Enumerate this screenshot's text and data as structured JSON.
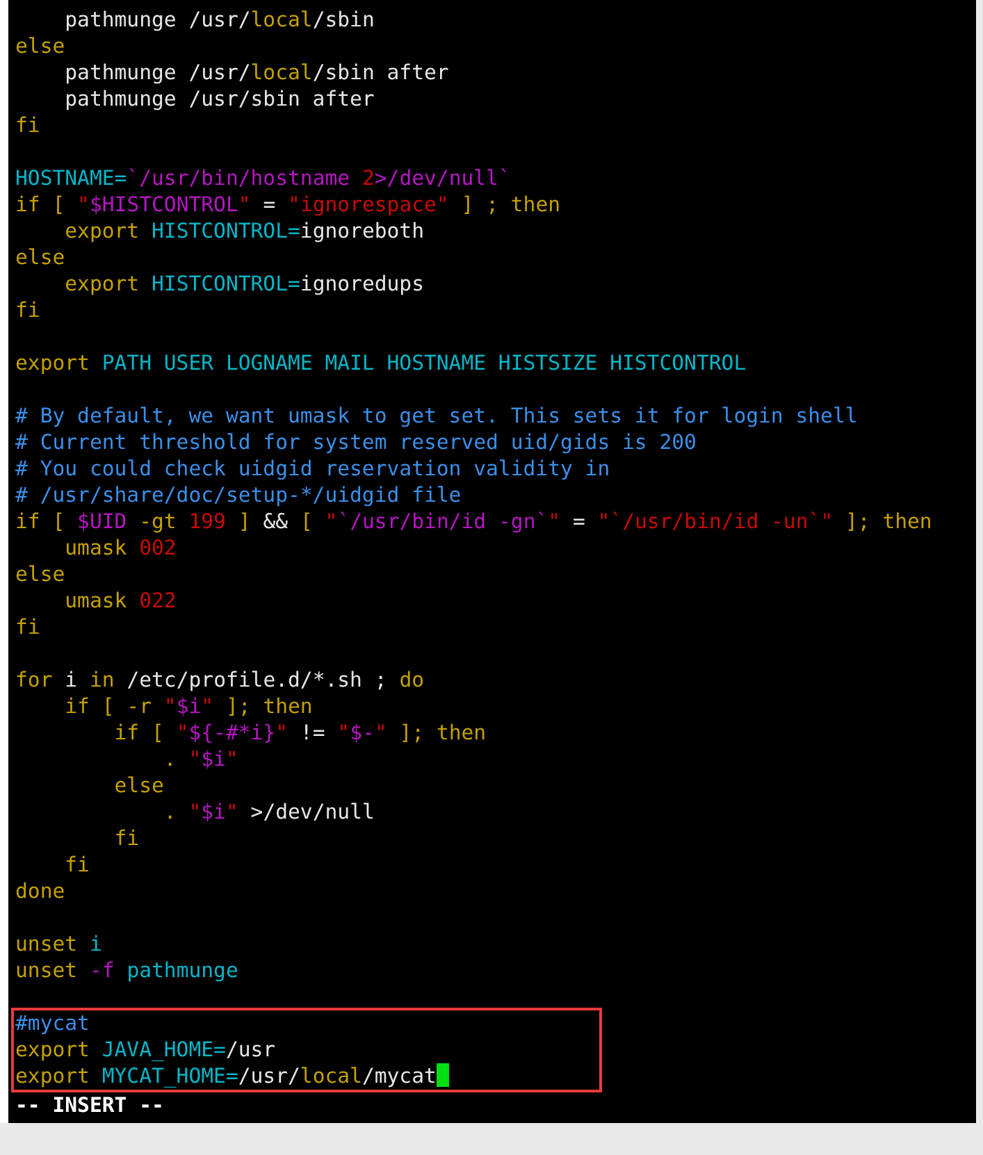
{
  "editor": {
    "blocks": [
      {
        "highlighted": false,
        "lines": [
          {
            "segments": [
              {
                "kind": "plain",
                "text": "    pathmunge /usr/"
              },
              {
                "kind": "keyword",
                "text": "local"
              },
              {
                "kind": "plain",
                "text": "/sbin"
              }
            ]
          },
          {
            "segments": [
              {
                "kind": "keyword",
                "text": "else"
              }
            ]
          },
          {
            "segments": [
              {
                "kind": "plain",
                "text": "    pathmunge /usr/"
              },
              {
                "kind": "keyword",
                "text": "local"
              },
              {
                "kind": "plain",
                "text": "/sbin after"
              }
            ]
          },
          {
            "segments": [
              {
                "kind": "plain",
                "text": "    pathmunge /usr/sbin after"
              }
            ]
          },
          {
            "segments": [
              {
                "kind": "keyword",
                "text": "fi"
              }
            ]
          }
        ]
      },
      {
        "highlighted": false,
        "lines": [
          {
            "segments": [
              {
                "kind": "ident",
                "text": "HOSTNAME="
              },
              {
                "kind": "var",
                "text": "`/usr/bin/hostname "
              },
              {
                "kind": "string",
                "text": "2"
              },
              {
                "kind": "var",
                "text": ">/dev/null`"
              }
            ]
          },
          {
            "segments": [
              {
                "kind": "keyword",
                "text": "if [ "
              },
              {
                "kind": "string",
                "text": "\""
              },
              {
                "kind": "var",
                "text": "$HISTCONTROL"
              },
              {
                "kind": "string",
                "text": "\""
              },
              {
                "kind": "plain",
                "text": " = "
              },
              {
                "kind": "string",
                "text": "\"ignorespace\""
              },
              {
                "kind": "keyword",
                "text": " ] ; then"
              }
            ]
          },
          {
            "segments": [
              {
                "kind": "keyword",
                "text": "    export "
              },
              {
                "kind": "ident",
                "text": "HISTCONTROL="
              },
              {
                "kind": "plain",
                "text": "ignoreboth"
              }
            ]
          },
          {
            "segments": [
              {
                "kind": "keyword",
                "text": "else"
              }
            ]
          },
          {
            "segments": [
              {
                "kind": "keyword",
                "text": "    export "
              },
              {
                "kind": "ident",
                "text": "HISTCONTROL="
              },
              {
                "kind": "plain",
                "text": "ignoredups"
              }
            ]
          },
          {
            "segments": [
              {
                "kind": "keyword",
                "text": "fi"
              }
            ]
          }
        ]
      },
      {
        "highlighted": false,
        "lines": [
          {
            "segments": [
              {
                "kind": "keyword",
                "text": "export "
              },
              {
                "kind": "ident",
                "text": "PATH USER LOGNAME MAIL HOSTNAME HISTSIZE HISTCONTROL"
              }
            ]
          }
        ]
      },
      {
        "highlighted": false,
        "lines": [
          {
            "segments": [
              {
                "kind": "comment",
                "text": "# By default, we want umask to get set. This sets it for login shell"
              }
            ]
          },
          {
            "segments": [
              {
                "kind": "comment",
                "text": "# Current threshold for system reserved uid/gids is 200"
              }
            ]
          },
          {
            "segments": [
              {
                "kind": "comment",
                "text": "# You could check uidgid reservation validity in"
              }
            ]
          },
          {
            "segments": [
              {
                "kind": "comment",
                "text": "# /usr/share/doc/setup-*/uidgid file"
              }
            ]
          },
          {
            "segments": [
              {
                "kind": "keyword",
                "text": "if [ "
              },
              {
                "kind": "var",
                "text": "$UID"
              },
              {
                "kind": "keyword",
                "text": " -gt "
              },
              {
                "kind": "string",
                "text": "199"
              },
              {
                "kind": "keyword",
                "text": " ] "
              },
              {
                "kind": "plain",
                "text": "&&"
              },
              {
                "kind": "keyword",
                "text": " [ "
              },
              {
                "kind": "string",
                "text": "\""
              },
              {
                "kind": "var",
                "text": "`/usr/bin/id -gn`"
              },
              {
                "kind": "string",
                "text": "\""
              },
              {
                "kind": "plain",
                "text": " = "
              },
              {
                "kind": "string",
                "text": "\"`/usr/bin/id -un`\""
              },
              {
                "kind": "keyword",
                "text": " ]; then"
              }
            ]
          },
          {
            "segments": [
              {
                "kind": "keyword",
                "text": "    umask "
              },
              {
                "kind": "string",
                "text": "002"
              }
            ]
          },
          {
            "segments": [
              {
                "kind": "keyword",
                "text": "else"
              }
            ]
          },
          {
            "segments": [
              {
                "kind": "keyword",
                "text": "    umask "
              },
              {
                "kind": "string",
                "text": "022"
              }
            ]
          },
          {
            "segments": [
              {
                "kind": "keyword",
                "text": "fi"
              }
            ]
          }
        ]
      },
      {
        "highlighted": false,
        "lines": [
          {
            "segments": [
              {
                "kind": "keyword",
                "text": "for"
              },
              {
                "kind": "plain",
                "text": " i "
              },
              {
                "kind": "keyword",
                "text": "in"
              },
              {
                "kind": "plain",
                "text": " /etc/profile.d/*.sh ; "
              },
              {
                "kind": "keyword",
                "text": "do"
              }
            ]
          },
          {
            "segments": [
              {
                "kind": "keyword",
                "text": "    if [ -r "
              },
              {
                "kind": "string",
                "text": "\""
              },
              {
                "kind": "var",
                "text": "$i"
              },
              {
                "kind": "string",
                "text": "\""
              },
              {
                "kind": "keyword",
                "text": " ]; then"
              }
            ]
          },
          {
            "segments": [
              {
                "kind": "keyword",
                "text": "        if [ "
              },
              {
                "kind": "string",
                "text": "\""
              },
              {
                "kind": "var",
                "text": "${-#*i}"
              },
              {
                "kind": "string",
                "text": "\""
              },
              {
                "kind": "plain",
                "text": " != "
              },
              {
                "kind": "string",
                "text": "\""
              },
              {
                "kind": "var",
                "text": "$-"
              },
              {
                "kind": "string",
                "text": "\""
              },
              {
                "kind": "keyword",
                "text": " ]; then"
              }
            ]
          },
          {
            "segments": [
              {
                "kind": "keyword",
                "text": "            . "
              },
              {
                "kind": "string",
                "text": "\""
              },
              {
                "kind": "var",
                "text": "$i"
              },
              {
                "kind": "string",
                "text": "\""
              }
            ]
          },
          {
            "segments": [
              {
                "kind": "keyword",
                "text": "        else"
              }
            ]
          },
          {
            "segments": [
              {
                "kind": "keyword",
                "text": "            . "
              },
              {
                "kind": "string",
                "text": "\""
              },
              {
                "kind": "var",
                "text": "$i"
              },
              {
                "kind": "string",
                "text": "\""
              },
              {
                "kind": "plain",
                "text": " >/dev/null"
              }
            ]
          },
          {
            "segments": [
              {
                "kind": "keyword",
                "text": "        fi"
              }
            ]
          },
          {
            "segments": [
              {
                "kind": "keyword",
                "text": "    fi"
              }
            ]
          },
          {
            "segments": [
              {
                "kind": "keyword",
                "text": "done"
              }
            ]
          }
        ]
      },
      {
        "highlighted": false,
        "lines": [
          {
            "segments": [
              {
                "kind": "keyword",
                "text": "unset "
              },
              {
                "kind": "ident",
                "text": "i"
              }
            ]
          },
          {
            "segments": [
              {
                "kind": "keyword",
                "text": "unset "
              },
              {
                "kind": "var",
                "text": "-f"
              },
              {
                "kind": "ident",
                "text": " pathmunge"
              }
            ]
          }
        ]
      },
      {
        "highlighted": true,
        "lines": [
          {
            "segments": [
              {
                "kind": "comment",
                "text": "#mycat"
              }
            ]
          },
          {
            "segments": [
              {
                "kind": "keyword",
                "text": "export "
              },
              {
                "kind": "ident",
                "text": "JAVA_HOME="
              },
              {
                "kind": "plain",
                "text": "/usr"
              }
            ]
          },
          {
            "segments": [
              {
                "kind": "keyword",
                "text": "export "
              },
              {
                "kind": "ident",
                "text": "MYCAT_HOME="
              },
              {
                "kind": "plain",
                "text": "/usr/"
              },
              {
                "kind": "keyword",
                "text": "local"
              },
              {
                "kind": "plain",
                "text": "/mycat"
              }
            ],
            "cursor": true
          }
        ]
      }
    ],
    "status_line": "-- INSERT --"
  }
}
